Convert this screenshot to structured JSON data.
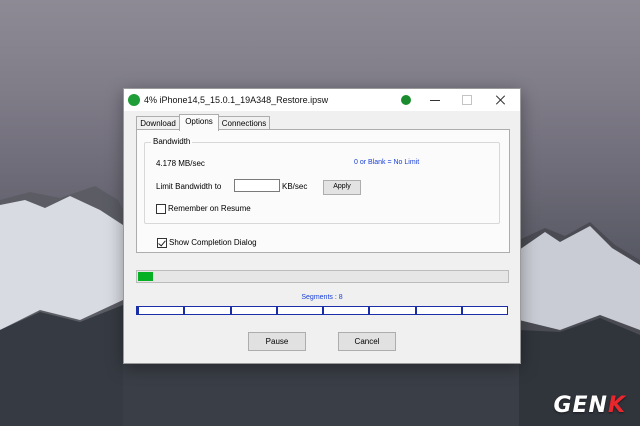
{
  "window": {
    "title": "4%  iPhone14,5_15.0.1_19A348_Restore.ipsw",
    "icon": "download-manager-icon"
  },
  "tabs": [
    {
      "label": "Download",
      "active": false
    },
    {
      "label": "Options",
      "active": true
    },
    {
      "label": "Connections",
      "active": false
    }
  ],
  "bandwidth": {
    "group_label": "Bandwidth",
    "speed": "4.178 MB/sec",
    "hint": "0 or Blank = No Limit",
    "limit_label": "Limit Bandwidth to",
    "limit_value": "",
    "unit": "KB/sec",
    "apply_label": "Apply",
    "remember_label": "Remember on Resume",
    "remember_checked": false
  },
  "completion": {
    "label": "Show Completion Dialog",
    "checked": true
  },
  "progress": {
    "fraction": 0.04,
    "color": "#06b025"
  },
  "segments": {
    "label": "Segments : 8",
    "count": 8,
    "color": "#1a2ea8"
  },
  "buttons": {
    "pause": "Pause",
    "cancel": "Cancel"
  },
  "watermark": {
    "text_main": "GEN",
    "text_accent": "K"
  }
}
